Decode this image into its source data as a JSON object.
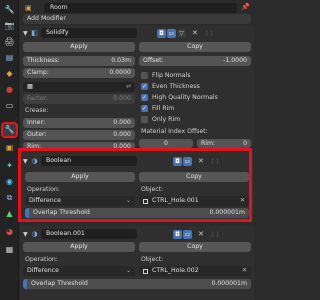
{
  "header": {
    "object_name": "Room",
    "add_modifier": "Add Modifier"
  },
  "tabs": [
    "tool-icon",
    "render-icon",
    "output-icon",
    "view-layer-icon",
    "scene-icon",
    "world-icon",
    "collection-icon",
    "object-icon",
    "modifier-icon",
    "particles-icon",
    "physics-icon",
    "constraints-icon",
    "data-icon",
    "material-icon",
    "texture-icon"
  ],
  "solidify": {
    "name": "Solidify",
    "apply": "Apply",
    "copy": "Copy",
    "thickness_label": "Thickness:",
    "thickness_value": "0.03m",
    "offset_label": "Offset:",
    "offset_value": "-1.0000",
    "clamp_label": "Clamp:",
    "clamp_value": "0.0000",
    "factor_label": "Factor:",
    "factor_value": "0.000",
    "crease_label": "Crease:",
    "inner_label": "Inner:",
    "inner_value": "0.000",
    "outer_label": "Outer:",
    "outer_value": "0.000",
    "rim_label": "Rim:",
    "rim_value": "0.000",
    "flip_normals": "Flip Normals",
    "even_thickness": "Even Thickness",
    "high_quality_normals": "High Quality Normals",
    "fill_rim": "Fill Rim",
    "only_rim": "Only Rim",
    "material_offset_label": "Material Index Offset:",
    "mat_value": "0",
    "rim_mat_label": "Rim:",
    "rim_mat_value": "0"
  },
  "boolean1": {
    "name": "Boolean",
    "apply": "Apply",
    "copy": "Copy",
    "operation_label": "Operation:",
    "operation_value": "Difference",
    "object_label": "Object:",
    "object_value": "CTRL_Hole.001",
    "overlap_label": "Overlap Threshold",
    "overlap_value": "0.000001m"
  },
  "boolean2": {
    "name": "Boolean.001",
    "apply": "Apply",
    "copy": "Copy",
    "operation_label": "Operation:",
    "operation_value": "Difference",
    "object_label": "Object:",
    "object_value": "CTRL_Hole.002",
    "overlap_label": "Overlap Threshold",
    "overlap_value": "0.000001m"
  }
}
